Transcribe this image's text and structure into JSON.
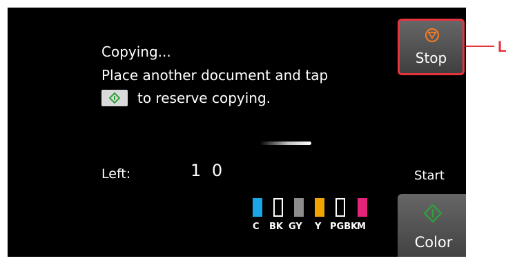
{
  "status": {
    "line1": "Copying...",
    "line2": "Place another document and tap",
    "line3": "to reserve copying."
  },
  "counter": {
    "label": "Left:",
    "value": "1 0"
  },
  "ink": [
    {
      "name": "C",
      "color": "#1aa7e8",
      "level": 1.0
    },
    {
      "name": "BK",
      "color": "#000000",
      "level": 0.0
    },
    {
      "name": "GY",
      "color": "#8c8c8c",
      "level": 1.0
    },
    {
      "name": "Y",
      "color": "#f0a400",
      "level": 1.0
    },
    {
      "name": "PGBK",
      "color": "#000000",
      "level": 0.0
    },
    {
      "name": "M",
      "color": "#e4237a",
      "level": 1.0
    }
  ],
  "buttons": {
    "stop_label": "Stop",
    "start_caption": "Start",
    "color_label": "Color"
  },
  "callout": {
    "letter": "L"
  },
  "colors": {
    "screen_bg": "#000000",
    "stop_border": "#e8343f",
    "start_green": "#2ea03a",
    "stop_icon": "#f07a28"
  },
  "icons": {
    "stop": "stop-icon",
    "start": "start-diamond-icon"
  }
}
